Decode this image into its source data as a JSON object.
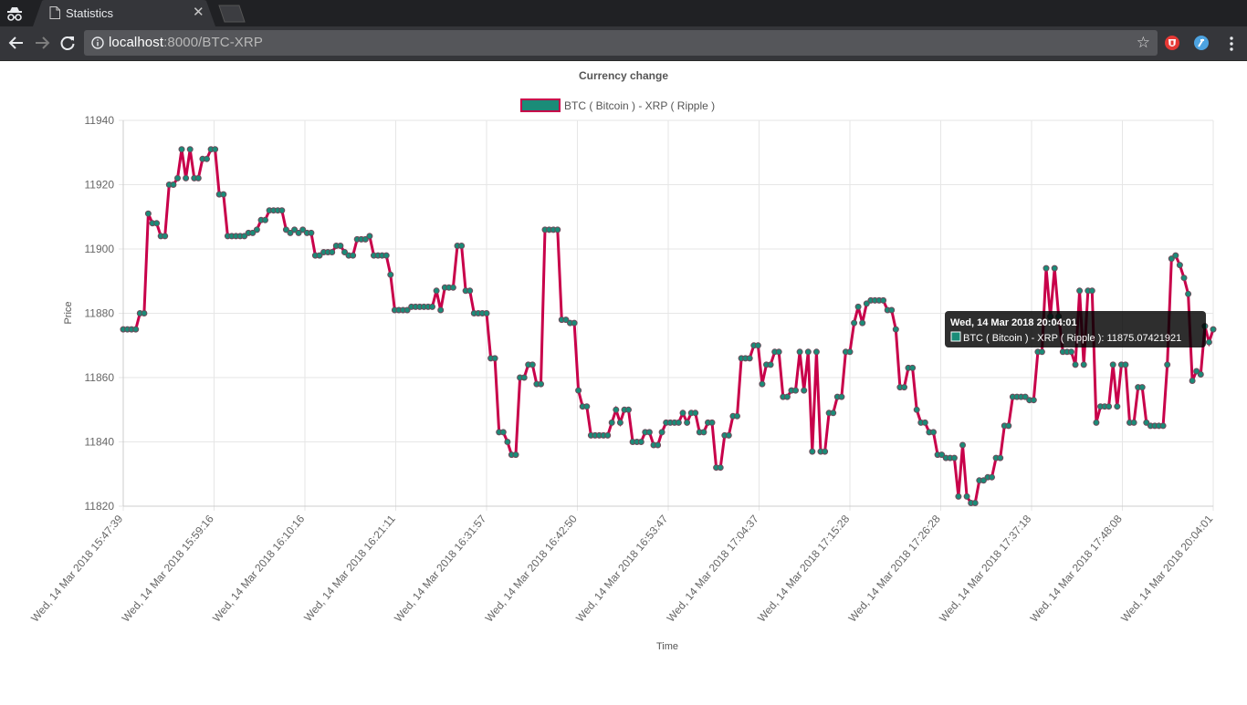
{
  "browser": {
    "tab_title": "Statistics",
    "url_host": "localhost",
    "url_path": ":8000/BTC-XRP"
  },
  "colors": {
    "line": "#c8004a",
    "point_fill": "#1a8c78",
    "point_border": "#6c4a5a",
    "tooltip_bg": "#000000"
  },
  "chart_data": {
    "type": "line",
    "title": "Currency change",
    "xlabel": "Time",
    "ylabel": "Price",
    "ylim": [
      11820,
      11940
    ],
    "yticks": [
      11820,
      11840,
      11860,
      11880,
      11900,
      11920,
      11940
    ],
    "xticks": [
      "Wed, 14 Mar 2018 15:47:39",
      "Wed, 14 Mar 2018 15:59:16",
      "Wed, 14 Mar 2018 16:10:16",
      "Wed, 14 Mar 2018 16:21:11",
      "Wed, 14 Mar 2018 16:31:57",
      "Wed, 14 Mar 2018 16:42:50",
      "Wed, 14 Mar 2018 16:53:47",
      "Wed, 14 Mar 2018 17:04:37",
      "Wed, 14 Mar 2018 17:15:28",
      "Wed, 14 Mar 2018 17:26:28",
      "Wed, 14 Mar 2018 17:37:18",
      "Wed, 14 Mar 2018 17:48:08",
      "Wed, 14 Mar 2018 20:04:01"
    ],
    "legend": "top-center",
    "grid": true,
    "series": [
      {
        "name": "BTC ( Bitcoin ) - XRP ( Ripple )",
        "values": [
          11875,
          11875,
          11875,
          11875,
          11880,
          11880,
          11911,
          11908,
          11908,
          11904,
          11904,
          11920,
          11920,
          11922,
          11931,
          11922,
          11931,
          11922,
          11922,
          11928,
          11928,
          11931,
          11931,
          11917,
          11917,
          11904,
          11904,
          11904,
          11904,
          11904,
          11905,
          11905,
          11906,
          11909,
          11909,
          11912,
          11912,
          11912,
          11912,
          11906,
          11905,
          11906,
          11905,
          11906,
          11905,
          11905,
          11898,
          11898,
          11899,
          11899,
          11899,
          11901,
          11901,
          11899,
          11898,
          11898,
          11903,
          11903,
          11903,
          11904,
          11898,
          11898,
          11898,
          11898,
          11892,
          11881,
          11881,
          11881,
          11881,
          11882,
          11882,
          11882,
          11882,
          11882,
          11882,
          11887,
          11881,
          11888,
          11888,
          11888,
          11901,
          11901,
          11887,
          11887,
          11880,
          11880,
          11880,
          11880,
          11866,
          11866,
          11843,
          11843,
          11840,
          11836,
          11836,
          11860,
          11860,
          11864,
          11864,
          11858,
          11858,
          11906,
          11906,
          11906,
          11906,
          11878,
          11878,
          11877,
          11877,
          11856,
          11851,
          11851,
          11842,
          11842,
          11842,
          11842,
          11842,
          11846,
          11850,
          11846,
          11850,
          11850,
          11840,
          11840,
          11840,
          11843,
          11843,
          11839,
          11839,
          11843,
          11846,
          11846,
          11846,
          11846,
          11849,
          11846,
          11849,
          11849,
          11843,
          11843,
          11846,
          11846,
          11832,
          11832,
          11842,
          11842,
          11848,
          11848,
          11866,
          11866,
          11866,
          11870,
          11870,
          11858,
          11864,
          11864,
          11868,
          11868,
          11854,
          11854,
          11856,
          11856,
          11868,
          11856,
          11868,
          11837,
          11868,
          11837,
          11837,
          11849,
          11849,
          11854,
          11854,
          11868,
          11868,
          11877,
          11882,
          11877,
          11883,
          11884,
          11884,
          11884,
          11884,
          11881,
          11881,
          11875,
          11857,
          11857,
          11863,
          11863,
          11850,
          11846,
          11846,
          11843,
          11843,
          11836,
          11836,
          11835,
          11835,
          11835,
          11823,
          11839,
          11823,
          11821,
          11821,
          11828,
          11828,
          11829,
          11829,
          11835,
          11835,
          11845,
          11845,
          11854,
          11854,
          11854,
          11854,
          11853,
          11853,
          11868,
          11868,
          11894,
          11879,
          11894,
          11879,
          11868,
          11868,
          11868,
          11864,
          11887,
          11864,
          11887,
          11887,
          11846,
          11851,
          11851,
          11851,
          11864,
          11851,
          11864,
          11864,
          11846,
          11846,
          11857,
          11857,
          11846,
          11845,
          11845,
          11845,
          11845,
          11864,
          11897,
          11898,
          11895,
          11891,
          11886,
          11859,
          11862,
          11861,
          11876,
          11871,
          11875
        ]
      }
    ],
    "tooltip": {
      "title": "Wed, 14 Mar 2018 20:04:01",
      "label": "BTC ( Bitcoin ) - XRP ( Ripple ): 11875.07421921"
    }
  }
}
